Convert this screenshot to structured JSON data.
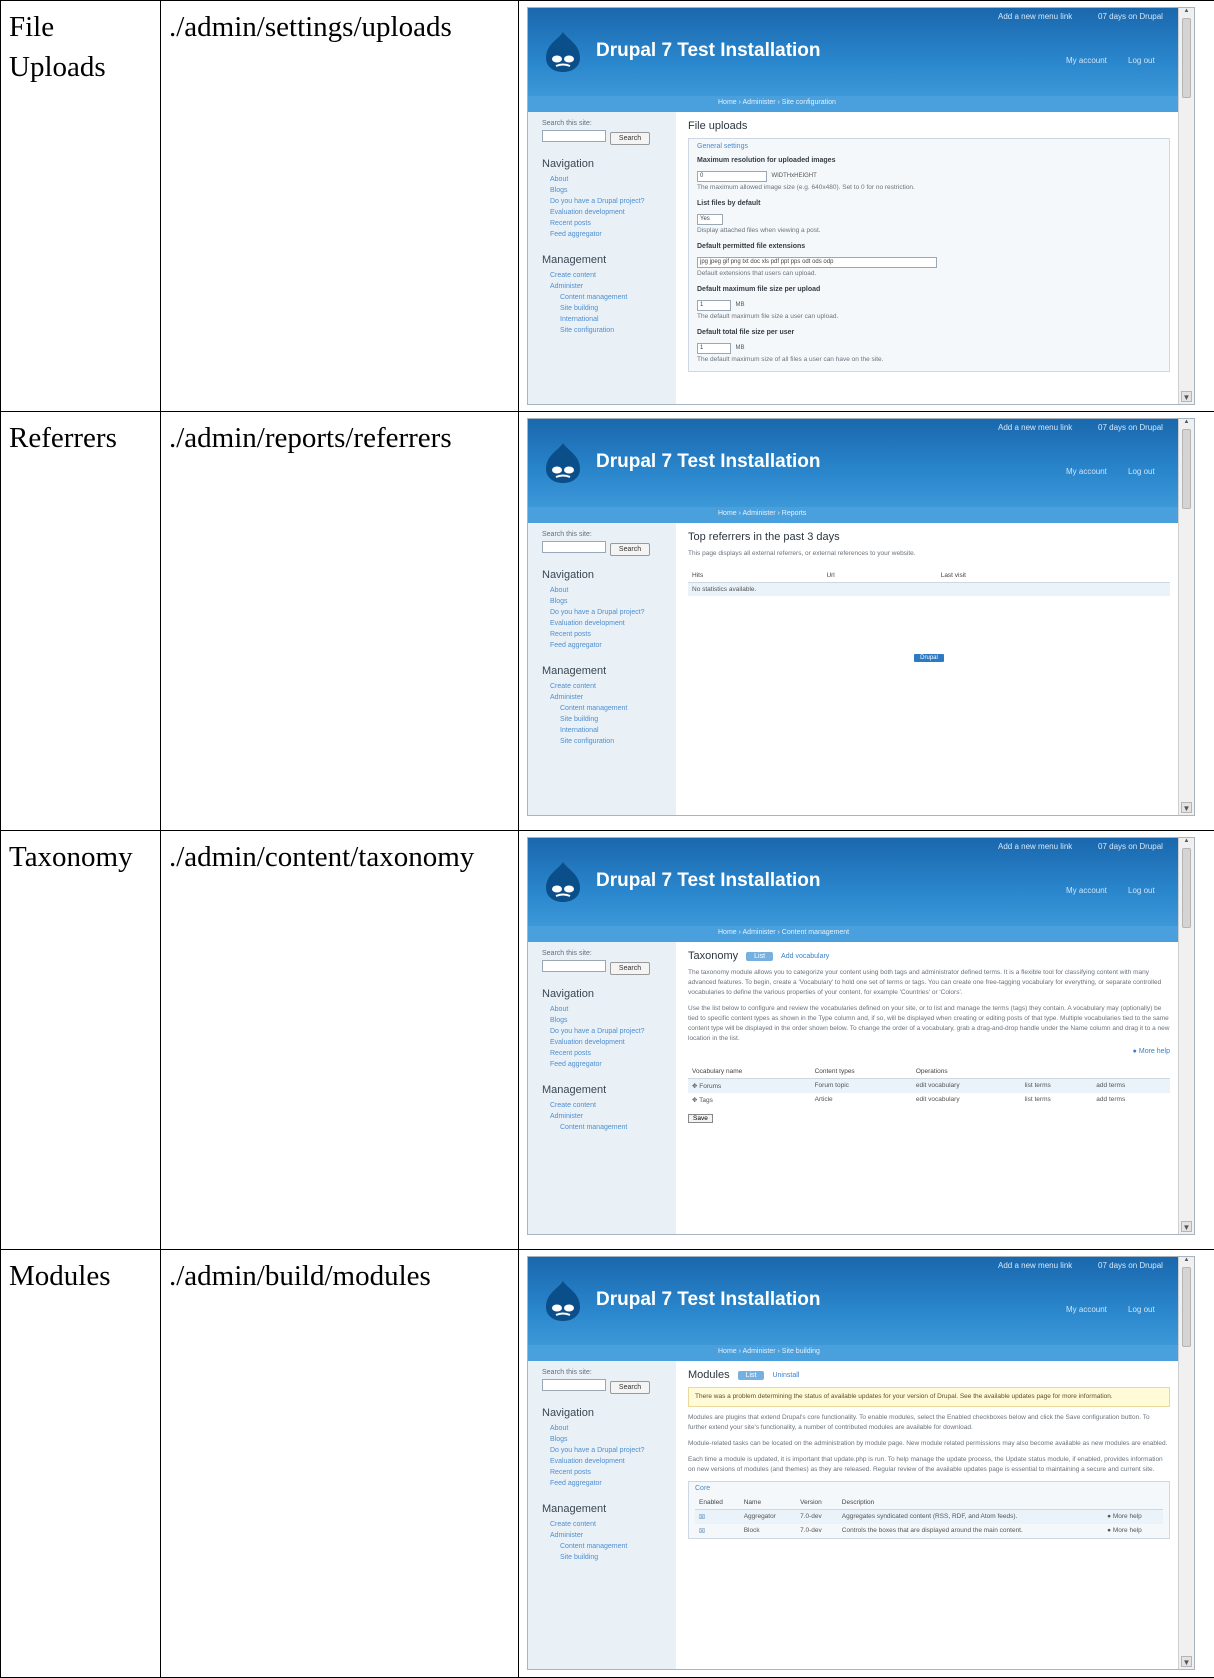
{
  "site_name": "Drupal 7 Test Installation",
  "header": {
    "user_link": "Add a new menu link",
    "user_link2": "07 days on Drupal",
    "my_account": "My account",
    "log_out": "Log out"
  },
  "sidebar": {
    "search_label": "Search this site:",
    "search_button": "Search",
    "nav_heading": "Navigation",
    "nav_items": [
      "About",
      "Blogs",
      "Do you have a Drupal project? ",
      "Evaluation development",
      "Recent posts",
      "Feed aggregator"
    ],
    "mgmt_heading": "Management",
    "mgmt_items": [
      "Create content",
      "Administer",
      "Content management",
      "Site building",
      "International",
      "Site configuration"
    ]
  },
  "rows": [
    {
      "name": "File Uploads",
      "path": "./admin/settings/uploads",
      "crumb": "Home › Administer › Site configuration",
      "page_title": "File uploads",
      "legend": "General settings",
      "fields": [
        {
          "label": "Maximum resolution for uploaded images",
          "value": "0",
          "suffix": "WIDTHxHEIGHT",
          "desc": "The maximum allowed image size (e.g. 640x480). Set to 0 for no restriction."
        },
        {
          "label": "List files by default",
          "value": "Yes",
          "desc": "Display attached files when viewing a post."
        },
        {
          "label": "Default permitted file extensions",
          "value": "jpg jpeg gif png txt doc xls pdf ppt pps odt ods odp",
          "desc": "Default extensions that users can upload."
        },
        {
          "label": "Default maximum file size per upload",
          "value": "1",
          "suffix": "MB",
          "desc": "The default maximum file size a user can upload."
        },
        {
          "label": "Default total file size per user",
          "value": "1",
          "suffix": "MB",
          "desc": "The default maximum size of all files a user can have on the site."
        }
      ]
    },
    {
      "name": "Referrers",
      "path": "./admin/reports/referrers",
      "crumb": "Home › Administer › Reports",
      "page_title": "Top referrers in the past 3 days",
      "intro": "This page displays all external referrers, or external references to your website.",
      "columns": [
        "Hits",
        "Url",
        "Last visit"
      ],
      "empty": "No statistics available.",
      "pager": "Drupal"
    },
    {
      "name": "Taxonomy",
      "path": "./admin/content/taxonomy",
      "crumb": "Home › Administer › Content management",
      "page_title": "Taxonomy",
      "tab_active": "List",
      "tab_other": "Add vocabulary",
      "para1": "The taxonomy module allows you to categorize your content using both tags and administrator defined terms. It is a flexible tool for classifying content with many advanced features. To begin, create a 'Vocabulary' to hold one set of terms or tags. You can create one free-tagging vocabulary for everything, or separate controlled vocabularies to define the various properties of your content, for example 'Countries' or 'Colors'.",
      "para2": "Use the list below to configure and review the vocabularies defined on your site, or to list and manage the terms (tags) they contain. A vocabulary may (optionally) be tied to specific content types as shown in the Type column and, if so, will be displayed when creating or editing posts of that type. Multiple vocabularies tied to the same content type will be displayed in the order shown below. To change the order of a vocabulary, grab a drag-and-drop handle under the Name column and drag it to a new location in the list.",
      "more_help": "More help",
      "columns": [
        "Vocabulary name",
        "Content types",
        "Operations"
      ],
      "vocabs": [
        {
          "name": "Forums",
          "types": "Forum topic",
          "edit": "edit vocabulary",
          "list": "list terms",
          "add": "add terms"
        },
        {
          "name": "Tags",
          "types": "Article",
          "edit": "edit vocabulary",
          "list": "list terms",
          "add": "add terms"
        }
      ],
      "save": "Save"
    },
    {
      "name": "Modules",
      "path": "./admin/build/modules",
      "crumb": "Home › Administer › Site building",
      "page_title": "Modules",
      "tab_active": "List",
      "tab_other": "Uninstall",
      "warning": "There was a problem determining the status of available updates for your version of Drupal. See the available updates page for more information.",
      "para1": "Modules are plugins that extend Drupal's core functionality. To enable modules, select the Enabled checkboxes below and click the Save configuration button. To further extend your site's functionality, a number of contributed modules are available for download.",
      "para2": "Module-related tasks can be located on the administration by module page. New module related permissions may also become available as new modules are enabled.",
      "para3": "Each time a module is updated, it is important that update.php is run. To help manage the update process, the Update status module, if enabled, provides information on new versions of modules (and themes) as they are released. Regular review of the available updates page is essential to maintaining a secure and current site.",
      "fieldset": "Core",
      "columns": [
        "Enabled",
        "Name",
        "Version",
        "Description"
      ],
      "modules": [
        {
          "name": "Aggregator",
          "version": "7.0-dev",
          "desc": "Aggregates syndicated content (RSS, RDF, and Atom feeds).",
          "help": "More help"
        },
        {
          "name": "Block",
          "version": "7.0-dev",
          "desc": "Controls the boxes that are displayed around the main content.",
          "help": "More help"
        }
      ]
    }
  ]
}
